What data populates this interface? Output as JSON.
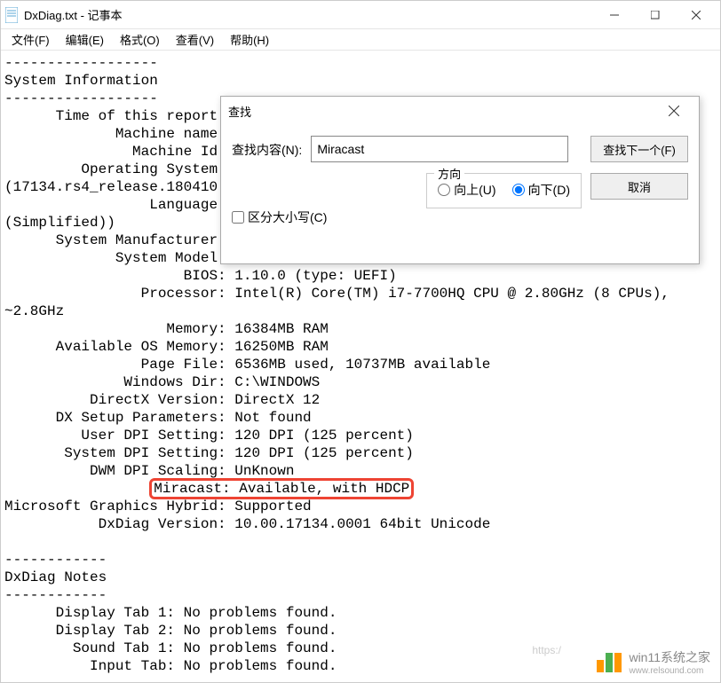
{
  "window": {
    "title": "DxDiag.txt - 记事本"
  },
  "menubar": {
    "file": "文件(F)",
    "edit": "编辑(E)",
    "format": "格式(O)",
    "view": "查看(V)",
    "help": "帮助(H)"
  },
  "dialog": {
    "title": "查找",
    "find_label": "查找内容(N):",
    "find_value": "Miracast",
    "find_next": "查找下一个(F)",
    "cancel": "取消",
    "match_case": "区分大小写(C)",
    "direction_legend": "方向",
    "dir_up": "向上(U)",
    "dir_down": "向下(D)"
  },
  "body": {
    "l1": "------------------",
    "l2": "System Information",
    "l3": "------------------",
    "l4": "      Time of this report",
    "l5": "             Machine name",
    "l6": "               Machine Id",
    "l7": "         Operating System",
    "l8": "(17134.rs4_release.180410",
    "l9": "                 Language",
    "l10": "(Simplified))",
    "l11": "      System Manufacturer",
    "l12": "             System Model",
    "l13": "                     BIOS: 1.10.0 (type: UEFI)",
    "l14": "                Processor: Intel(R) Core(TM) i7-7700HQ CPU @ 2.80GHz (8 CPUs),",
    "l15": "~2.8GHz",
    "l16": "                   Memory: 16384MB RAM",
    "l17": "      Available OS Memory: 16250MB RAM",
    "l18": "                Page File: 6536MB used, 10737MB available",
    "l19": "              Windows Dir: C:\\WINDOWS",
    "l20": "          DirectX Version: DirectX 12",
    "l21": "      DX Setup Parameters: Not found",
    "l22": "         User DPI Setting: 120 DPI (125 percent)",
    "l23": "       System DPI Setting: 120 DPI (125 percent)",
    "l24": "          DWM DPI Scaling: UnKnown",
    "l25a": "                 ",
    "l25b": "Miracast: Available, with HDCP",
    "l26": "Microsoft Graphics Hybrid: Supported",
    "l27": "           DxDiag Version: 10.00.17134.0001 64bit Unicode",
    "l28": "",
    "l29": "------------",
    "l30": "DxDiag Notes",
    "l31": "------------",
    "l32": "      Display Tab 1: No problems found.",
    "l33": "      Display Tab 2: No problems found.",
    "l34": "        Sound Tab 1: No problems found.",
    "l35": "          Input Tab: No problems found."
  },
  "watermark": {
    "text": "win11系统之家",
    "sub": "www.relsound.com"
  },
  "footer_url": "https:/"
}
